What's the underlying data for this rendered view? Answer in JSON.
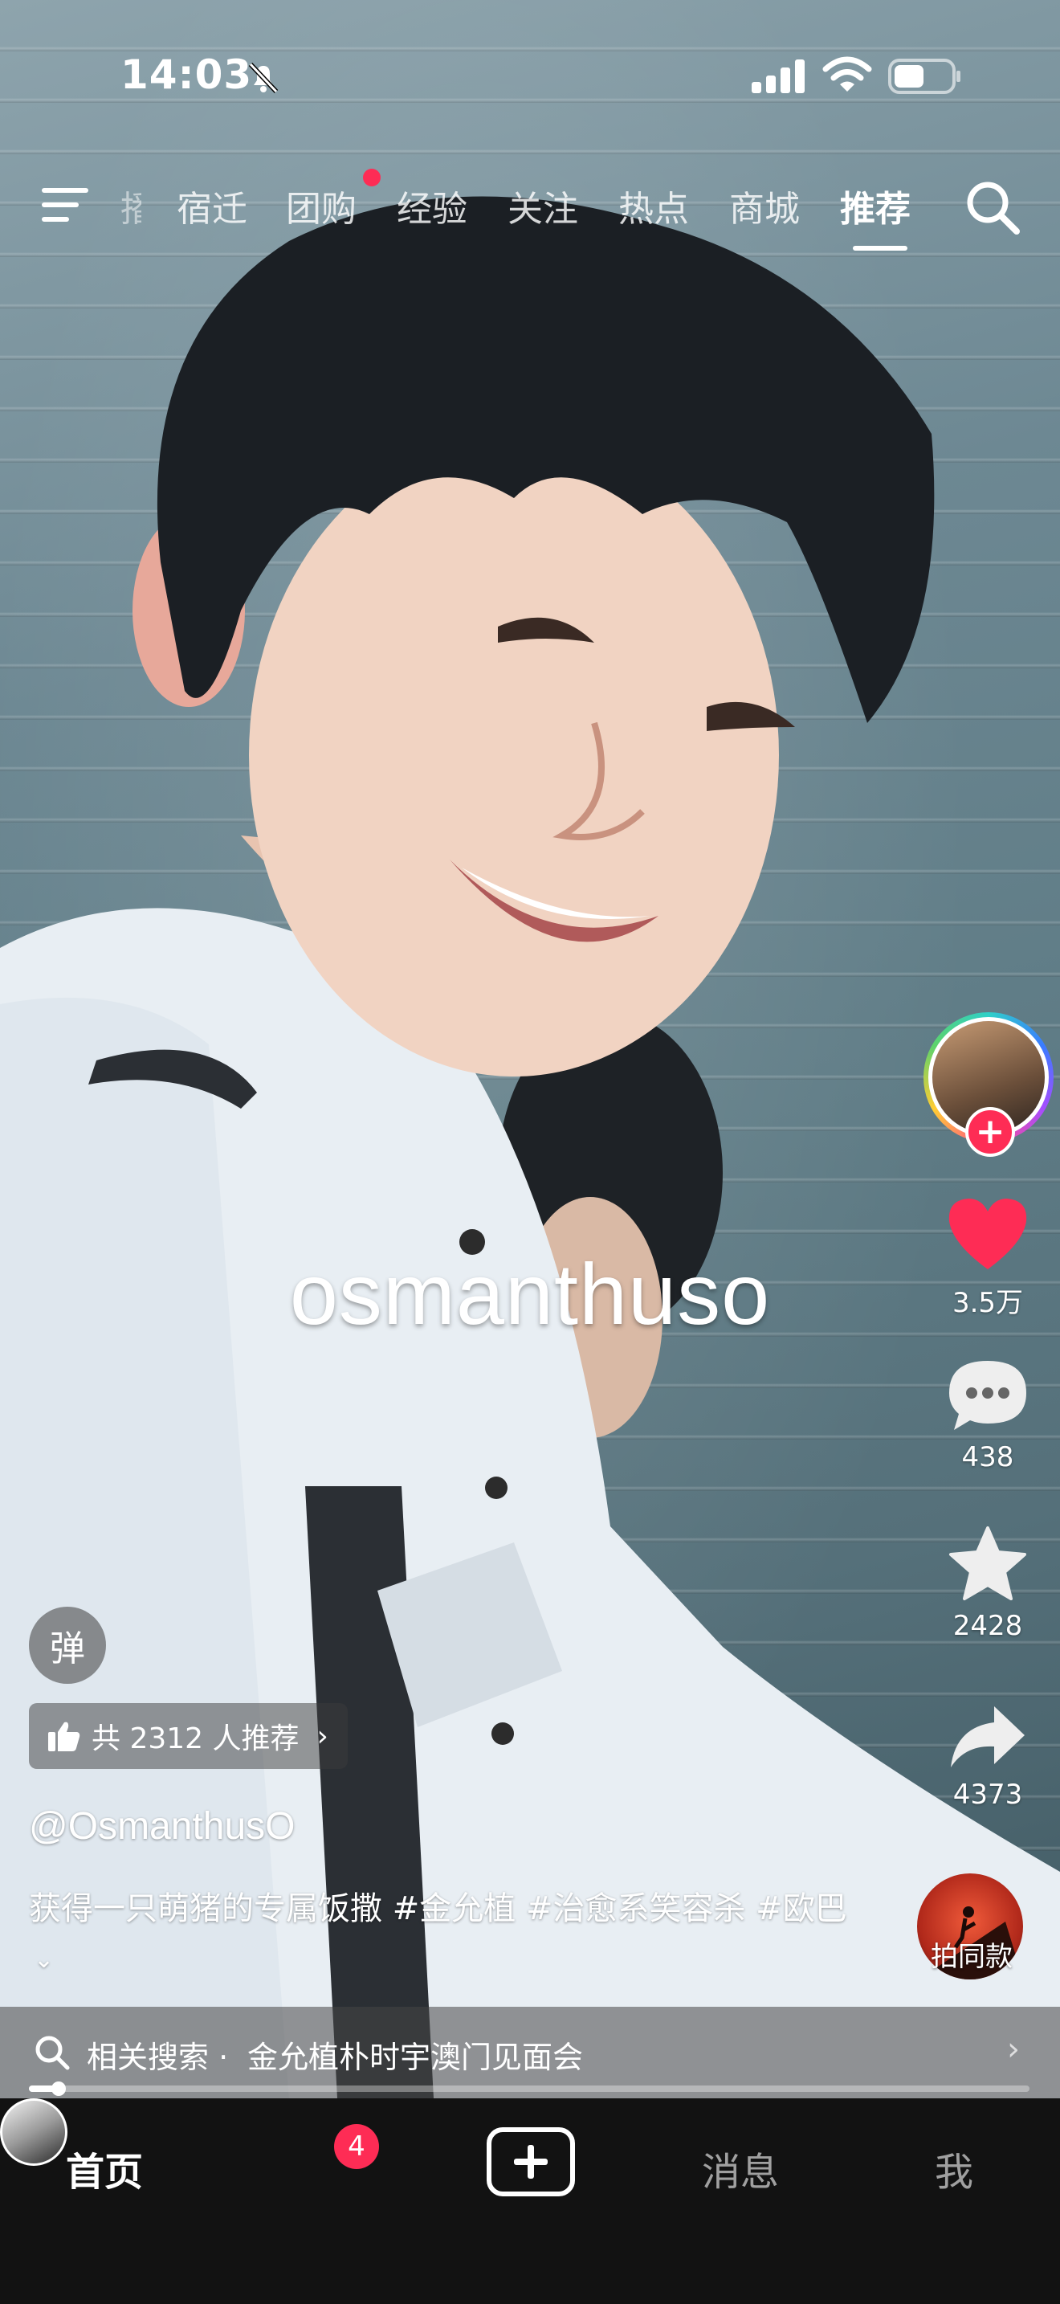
{
  "status_bar": {
    "time": "14:03"
  },
  "top_nav": {
    "tabs": [
      {
        "label": "宿迁",
        "active": false
      },
      {
        "label": "团购",
        "active": false,
        "red_dot": true
      },
      {
        "label": "经验",
        "active": false
      },
      {
        "label": "关注",
        "active": false
      },
      {
        "label": "热点",
        "active": false
      },
      {
        "label": "商城",
        "active": false
      },
      {
        "label": "推荐",
        "active": true
      }
    ],
    "partial_tab": "播"
  },
  "video": {
    "overlay_text": "osmanthuso"
  },
  "actions": {
    "like_count": "3.5万",
    "comment_count": "438",
    "favorite_count": "2428",
    "share_count": "4373",
    "same_style_label": "拍同款",
    "follow_symbol": "+"
  },
  "info": {
    "danmaku_label": "弹",
    "recommend_text": "共 2312 人推荐",
    "author": "@OsmanthusO",
    "caption": "获得一只萌猪的专属饭撒 #金允植 #治愈系笑容杀 #欧巴"
  },
  "related_search": {
    "label": "相关搜索",
    "separator": "·",
    "query": "金允植朴时宇澳门见面会",
    "progress": 0.03
  },
  "bottom_tabs": {
    "home": "首页",
    "friends_badge": "4",
    "messages": "消息",
    "me": "我"
  },
  "colors": {
    "accent": "#fe2c55",
    "tab_bar": "#121212"
  }
}
